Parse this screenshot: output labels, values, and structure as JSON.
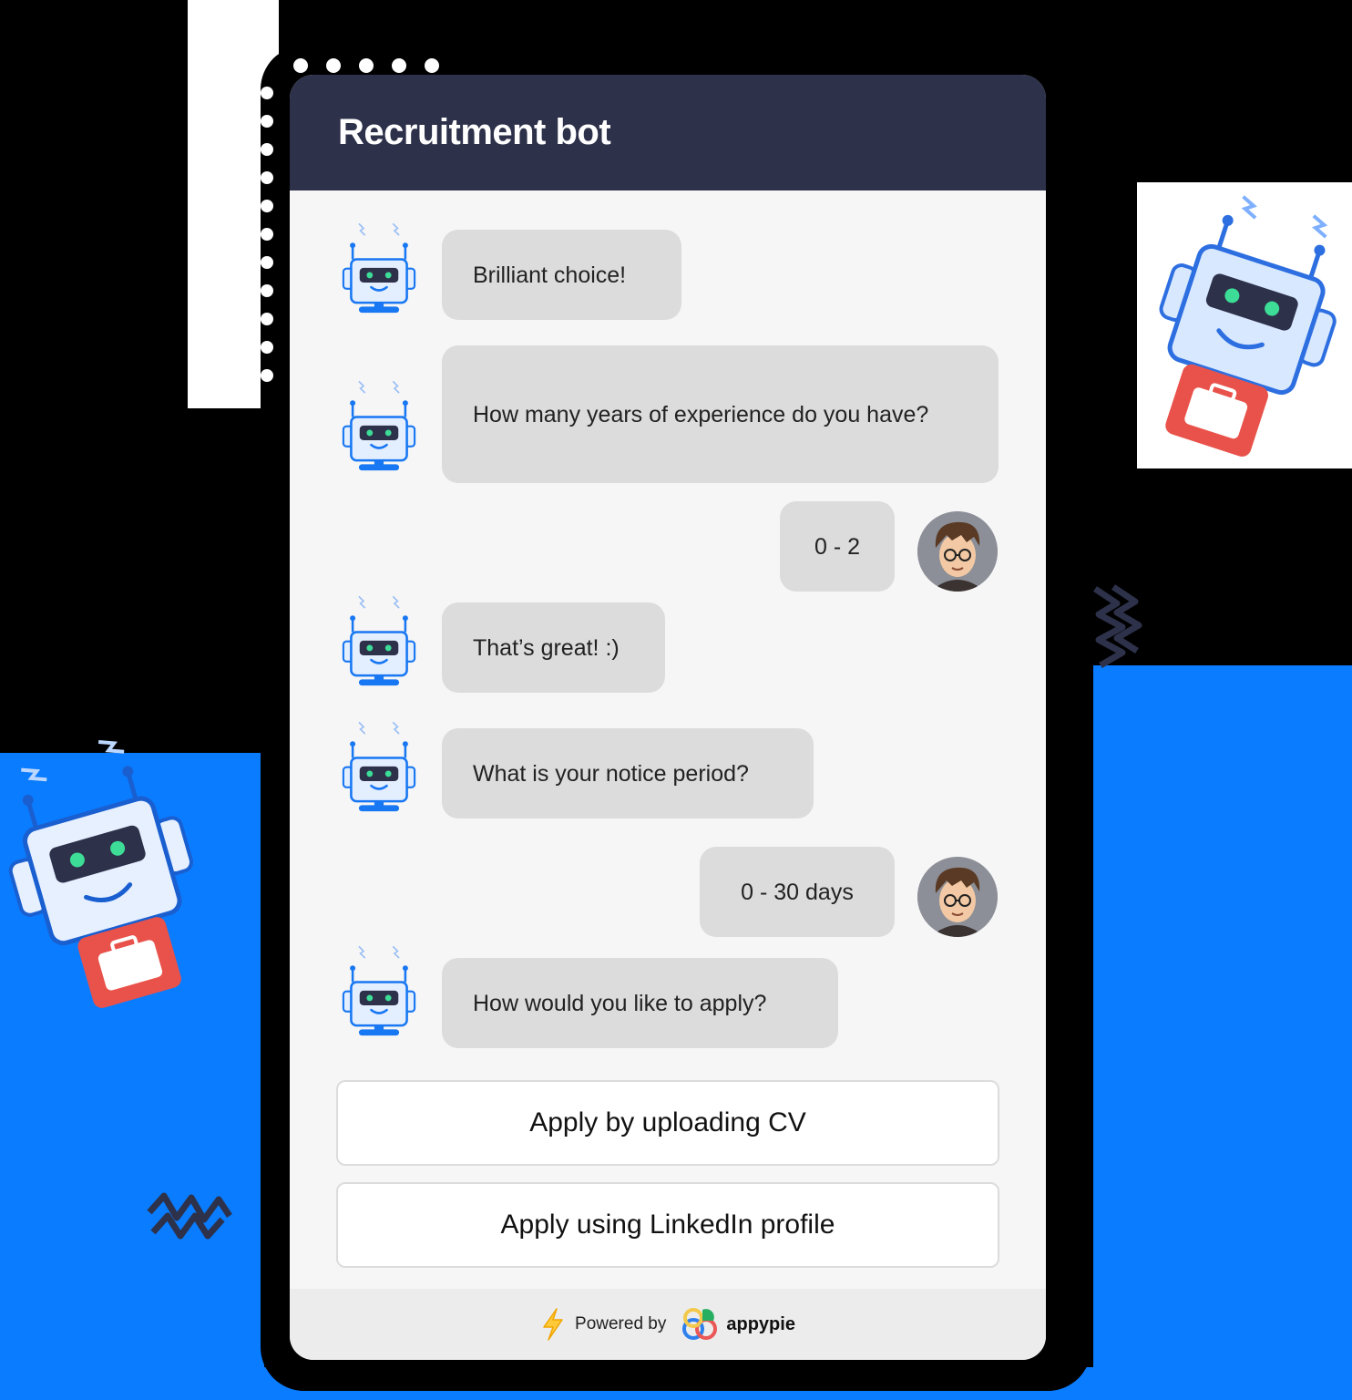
{
  "header": {
    "title": "Recruitment bot"
  },
  "messages": [
    {
      "from": "bot",
      "text": "Brilliant choice!"
    },
    {
      "from": "bot",
      "text": "How many years of experience do you have?"
    },
    {
      "from": "user",
      "text": "0 - 2"
    },
    {
      "from": "bot",
      "text": "That’s great! :)"
    },
    {
      "from": "bot",
      "text": "What is your notice period?"
    },
    {
      "from": "user",
      "text": "0 - 30 days"
    },
    {
      "from": "bot",
      "text": "How would you like to apply?"
    }
  ],
  "options": [
    {
      "label": "Apply by uploading CV"
    },
    {
      "label": "Apply using LinkedIn profile"
    }
  ],
  "footer": {
    "powered_by": "Powered by",
    "brand": "appypie"
  },
  "colors": {
    "header_bg": "#2d314a",
    "bubble_bg": "#dcdcdc",
    "accent_blue": "#0a7cff",
    "briefcase_red": "#e8524a"
  },
  "icons": {
    "bot": "robot-icon",
    "user": "user-avatar",
    "lightning": "lightning-icon",
    "brand_logo": "appypie-logo-icon"
  }
}
